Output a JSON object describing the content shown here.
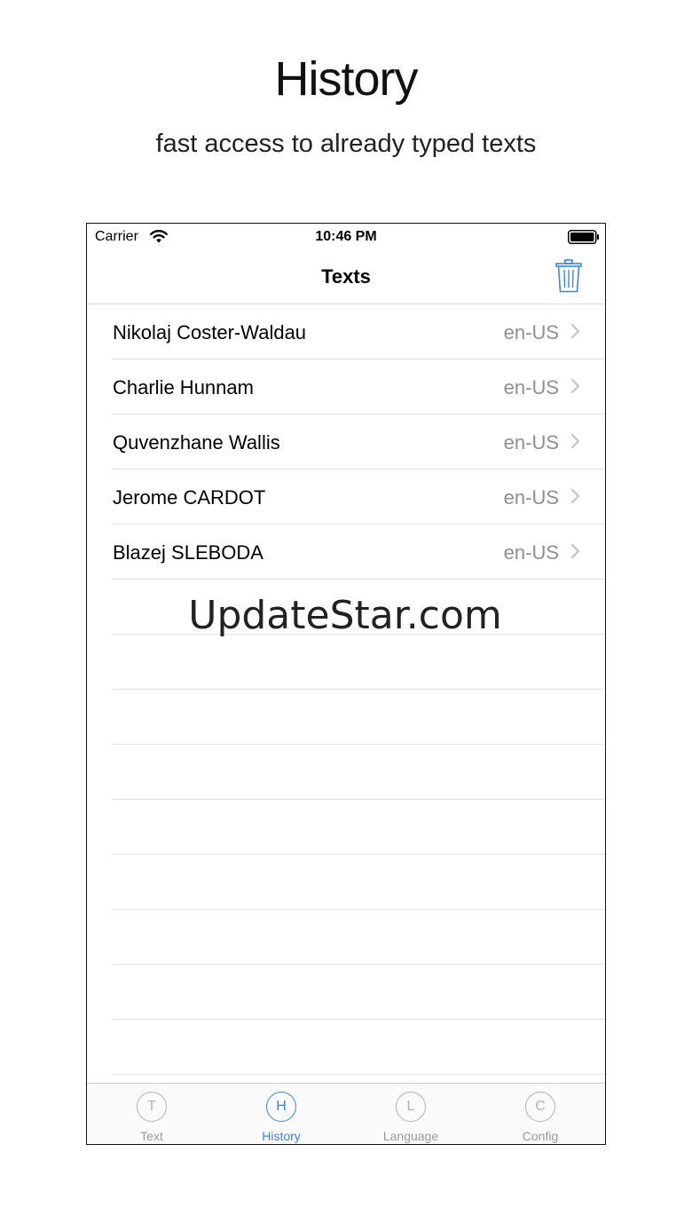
{
  "promo": {
    "title": "History",
    "subtitle": "fast access to already typed texts"
  },
  "status_bar": {
    "carrier": "Carrier",
    "time": "10:46 PM",
    "wifi_icon": "wifi-icon",
    "battery_icon": "battery-full-icon"
  },
  "nav": {
    "title": "Texts",
    "trash_icon": "trash-icon"
  },
  "colors": {
    "accent": "#3b86d8",
    "secondary_text": "#8e8e93",
    "separator": "#e3e3e3"
  },
  "history": [
    {
      "name": "Nikolaj Coster-Waldau",
      "lang": "en-US"
    },
    {
      "name": "Charlie Hunnam",
      "lang": "en-US"
    },
    {
      "name": "Quvenzhane Wallis",
      "lang": "en-US"
    },
    {
      "name": "Jerome CARDOT",
      "lang": "en-US"
    },
    {
      "name": "Blazej SLEBODA",
      "lang": "en-US"
    }
  ],
  "watermark": "UpdateStar.com",
  "tabs": [
    {
      "letter": "T",
      "label": "Text"
    },
    {
      "letter": "H",
      "label": "History"
    },
    {
      "letter": "L",
      "label": "Language"
    },
    {
      "letter": "C",
      "label": "Config"
    }
  ]
}
